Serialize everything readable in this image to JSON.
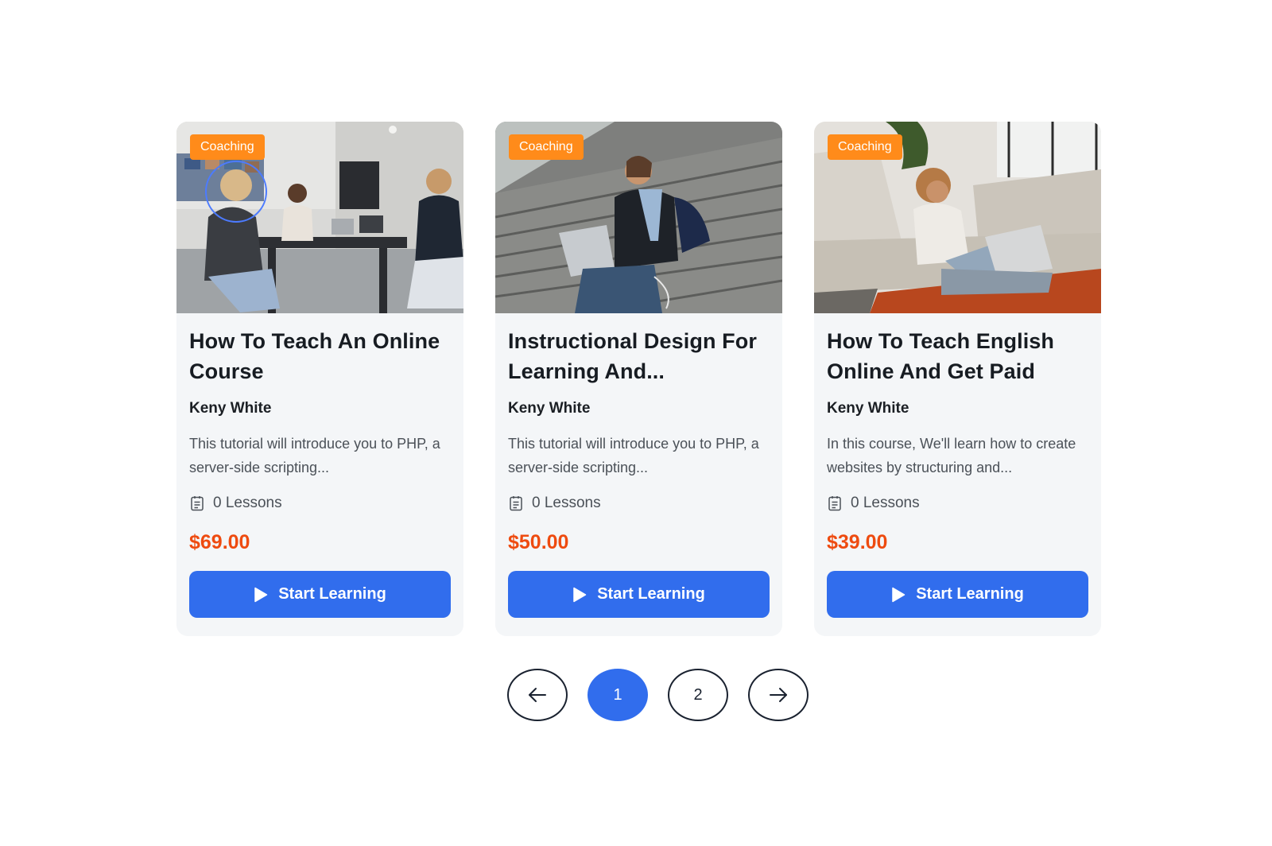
{
  "courses": [
    {
      "category": "Coaching",
      "title": "How To Teach An Online Course",
      "author": "Keny White",
      "description": "This tutorial will introduce you to PHP, a server-side scripting...",
      "lessons": "0 Lessons",
      "price": "$69.00",
      "button": "Start Learning",
      "image": "photo-women-working-at-table-with-laptops"
    },
    {
      "category": "Coaching",
      "title": "Instructional Design For Learning And...",
      "author": "Keny White",
      "description": "This tutorial will introduce you to PHP, a server-side scripting...",
      "lessons": "0 Lessons",
      "price": "$50.00",
      "button": "Start Learning",
      "image": "photo-woman-with-laptop-on-stairs"
    },
    {
      "category": "Coaching",
      "title": "How To Teach English Online And Get Paid",
      "author": "Keny White",
      "description": "In this course, We'll learn how to create websites by structuring and...",
      "lessons": "0 Lessons",
      "price": "$39.00",
      "button": "Start Learning",
      "image": "photo-woman-with-laptop-on-floor-by-sofa"
    }
  ],
  "pagination": {
    "prev_icon": "arrow-left-icon",
    "pages": [
      "1",
      "2"
    ],
    "current": "1",
    "next_icon": "arrow-right-icon"
  },
  "colors": {
    "badge": "#ff8b1a",
    "price": "#ee4b10",
    "button": "#316ded",
    "card_bg": "#f4f6f8"
  }
}
